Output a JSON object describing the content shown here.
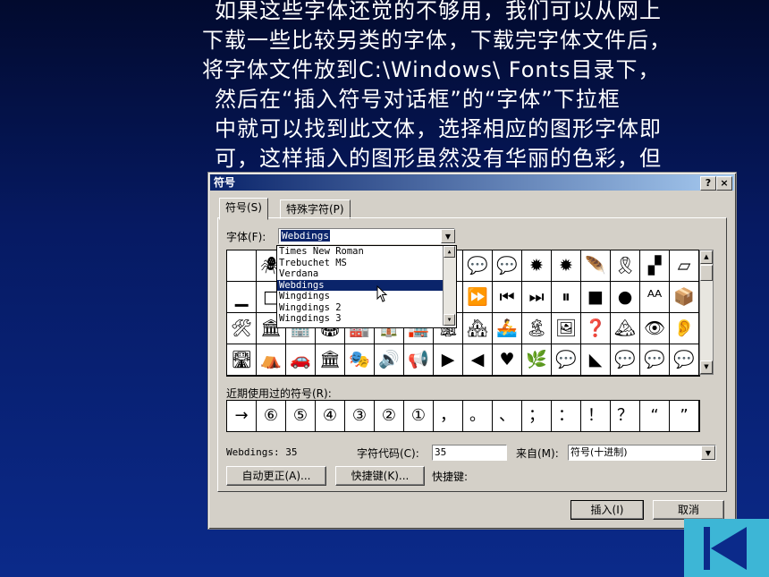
{
  "slide": {
    "lines": [
      "如果这些字体还觉的不够用，我们可以从网上",
      "下载一些比较另类的字体，下载完字体文件后，",
      "将字体文件放到C:\\Windows\\ Fonts目录下，",
      "然后在“插入符号对话框”的“字体”下拉框",
      "中就可以找到此文体，选择相应的图形字体即",
      "可，这样插入的图形虽然没有华丽的色彩，但"
    ]
  },
  "dialog": {
    "title": "符号",
    "help_label": "?",
    "close_label": "×",
    "tabs": [
      "符号(S)",
      "特殊字符(P)"
    ],
    "font_label": "字体(F):",
    "font_value": "Webdings",
    "font_options": [
      "Times New Roman",
      "Trebuchet MS",
      "Verdana",
      "Webdings",
      "Wingdings",
      "Wingdings 2",
      "Wingdings 3"
    ],
    "grid_rows": [
      [
        "",
        "🕷",
        "",
        "",
        "",
        "",
        "",
        "",
        "💬",
        "💬",
        "✹",
        "✹",
        "🪶",
        "🎗",
        "▞",
        "▱"
      ],
      [
        "▁",
        "□",
        "",
        "",
        "",
        "",
        "",
        "",
        "⏩",
        "⏮",
        "⏭",
        "⏸",
        "■",
        "●",
        "ᴬᴬ",
        "📦"
      ],
      [
        "🛠",
        "🏛",
        "🏢",
        "🏟",
        "🏭",
        "🏠",
        "🏣",
        "🏚",
        "🏘",
        "🚣",
        "🏝",
        "🖼",
        "❓",
        "🏔",
        "👁",
        "👂"
      ],
      [
        "🛣",
        "⛺",
        "🚗",
        "🏛",
        "🎭",
        "🔊",
        "📢",
        "▶",
        "◀",
        "♥",
        "🌿",
        "💬",
        "◣",
        "💬",
        "💬",
        "💬"
      ]
    ],
    "recent_label": "近期使用过的符号(R):",
    "recent_symbols": [
      "→",
      "⑥",
      "⑤",
      "④",
      "③",
      "②",
      "①",
      "，",
      "。",
      "、",
      "；",
      "：",
      "！",
      "？",
      "“",
      "”"
    ],
    "char_info": "Webdings: 35",
    "char_code_label": "字符代码(C):",
    "char_code_value": "35",
    "from_label": "来自(M):",
    "from_value": "符号(十进制)",
    "autocorrect_label": "自动更正(A)...",
    "shortcut_key_label": "快捷键(K)...",
    "shortcut_label": "快捷键:",
    "insert_label": "插入(I)",
    "cancel_label": "取消"
  }
}
